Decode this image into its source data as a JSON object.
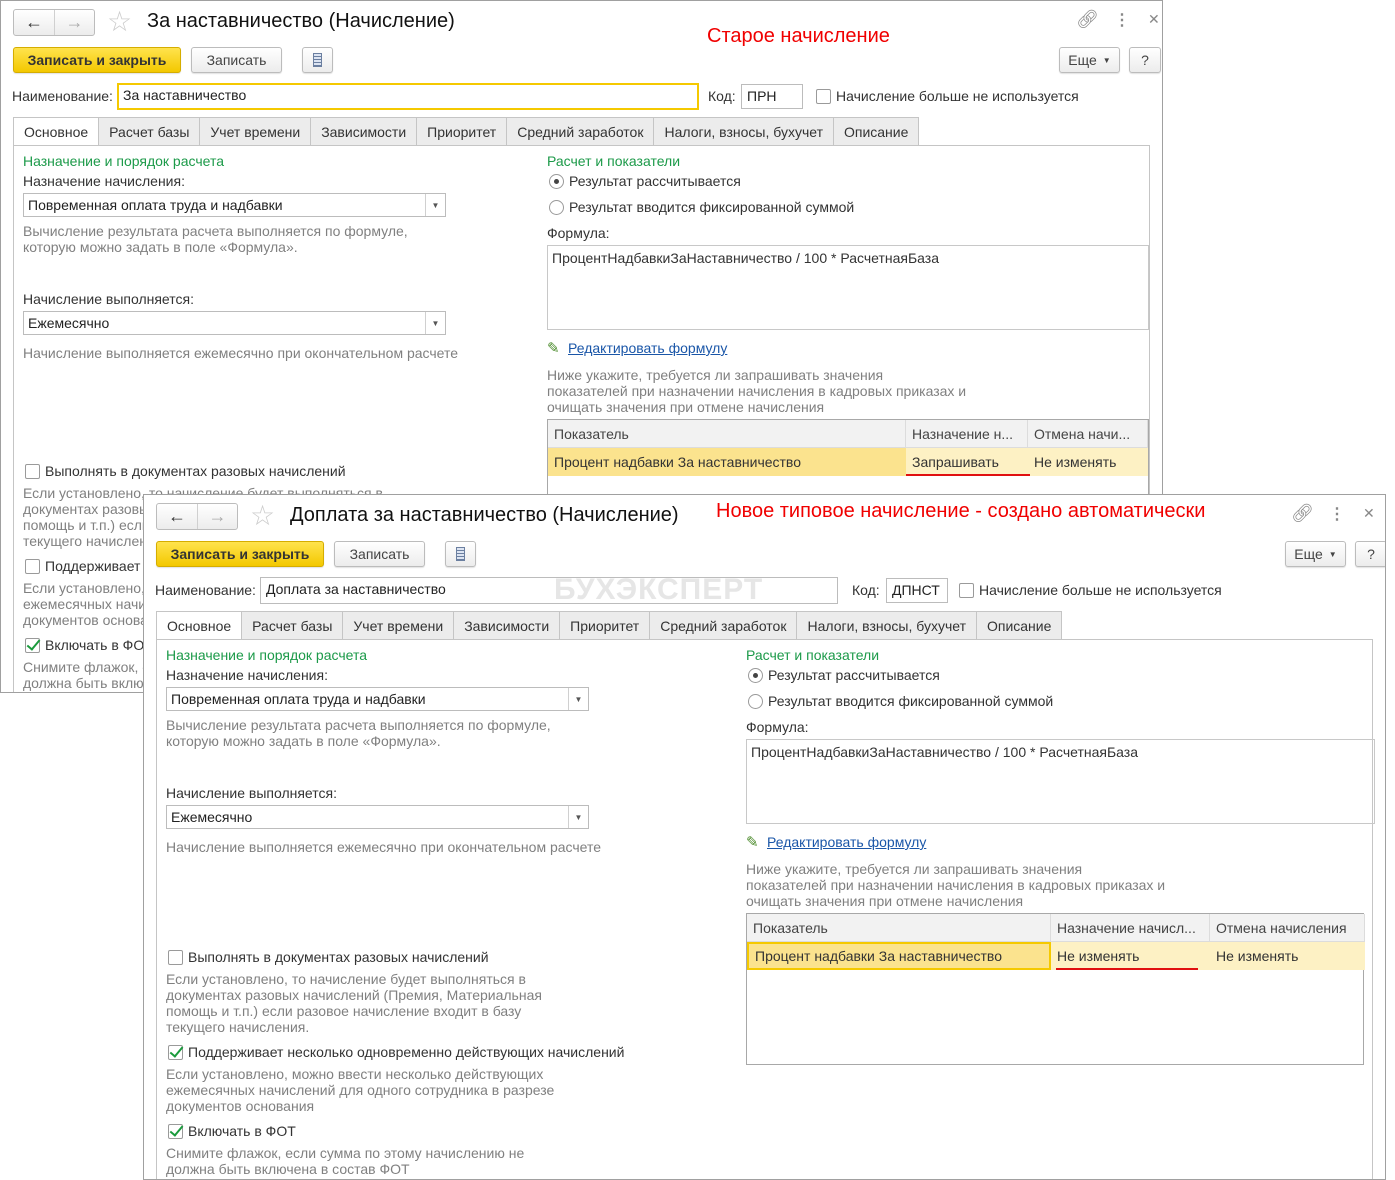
{
  "annotations": {
    "old": "Старое начисление",
    "new": "Новое типовое начисление - создано автоматически"
  },
  "watermark": "БУХЭКСПЕРТ",
  "colors": {
    "accent_yellow": "#f5c900",
    "annotation_red": "#f00000",
    "heading_green": "#1c9a49",
    "link_blue": "#1a56a8"
  },
  "common": {
    "save_close": "Записать и закрыть",
    "save": "Записать",
    "more": "Еще",
    "help": "?",
    "name_label": "Наименование:",
    "code_label": "Код:",
    "unused_label": "Начисление больше не используется",
    "tabs": [
      "Основное",
      "Расчет базы",
      "Учет времени",
      "Зависимости",
      "Приоритет",
      "Средний заработок",
      "Налоги, взносы, бухучет",
      "Описание"
    ],
    "left_heading": "Назначение и порядок расчета",
    "purpose_label": "Назначение начисления:",
    "purpose_value": "Повременная оплата труда и надбавки",
    "purpose_desc": "Вычисление результата расчета выполняется по формуле, которую можно задать в поле «Формула».",
    "period_label": "Начисление выполняется:",
    "period_value": "Ежемесячно",
    "period_desc": "Начисление выполняется ежемесячно при окончательном расчете",
    "cb1_label": "Выполнять в документах разовых начислений",
    "cb1_desc": "Если установлено, то начисление будет выполняться в документах разовых начислений (Премия, Материальная помощь и т.п.) если разовое начисление входит в базу текущего начисления.",
    "cb2_label": "Поддерживает несколько одновременно действующих начислений",
    "cb2_desc": "Если установлено, можно ввести несколько действующих ежемесячных начислений для одного сотрудника в разрезе документов основания",
    "cb3_label": "Включать в ФОТ",
    "cb3_desc": "Снимите флажок, если сумма по этому начислению не должна быть включена в состав ФОТ",
    "right_heading": "Расчет и показатели",
    "radio1": "Результат рассчитывается",
    "radio2": "Результат вводится фиксированной суммой",
    "formula_label": "Формула:",
    "formula": "ПроцентНадбавкиЗаНаставничество / 100 * РасчетнаяБаза",
    "edit_formula": "Редактировать формулу",
    "indicators_desc": "Ниже укажите, требуется ли запрашивать значения показателей при назначении начисления в кадровых приказах и очищать значения при отмене начисления"
  },
  "windows": [
    {
      "title": "За наставничество (Начисление)",
      "name_value": "За наставничество",
      "code_value": "ПРН",
      "unused_checked": false,
      "cb1_checked": false,
      "cb2_checked": false,
      "cb3_checked": true,
      "table": {
        "headers": [
          "Показатель",
          "Назначение н...",
          "Отмена начи..."
        ],
        "rows": [
          [
            "Процент надбавки За наставничество",
            "Запрашивать",
            "Не изменять"
          ]
        ]
      }
    },
    {
      "title": "Доплата за наставничество (Начисление)",
      "name_value": "Доплата за наставничество",
      "code_value": "ДПНСТ",
      "unused_checked": false,
      "cb1_checked": false,
      "cb2_checked": true,
      "cb3_checked": true,
      "table": {
        "headers": [
          "Показатель",
          "Назначение начисл...",
          "Отмена начисления"
        ],
        "rows": [
          [
            "Процент надбавки За наставничество",
            "Не изменять",
            "Не изменять"
          ]
        ]
      }
    }
  ]
}
